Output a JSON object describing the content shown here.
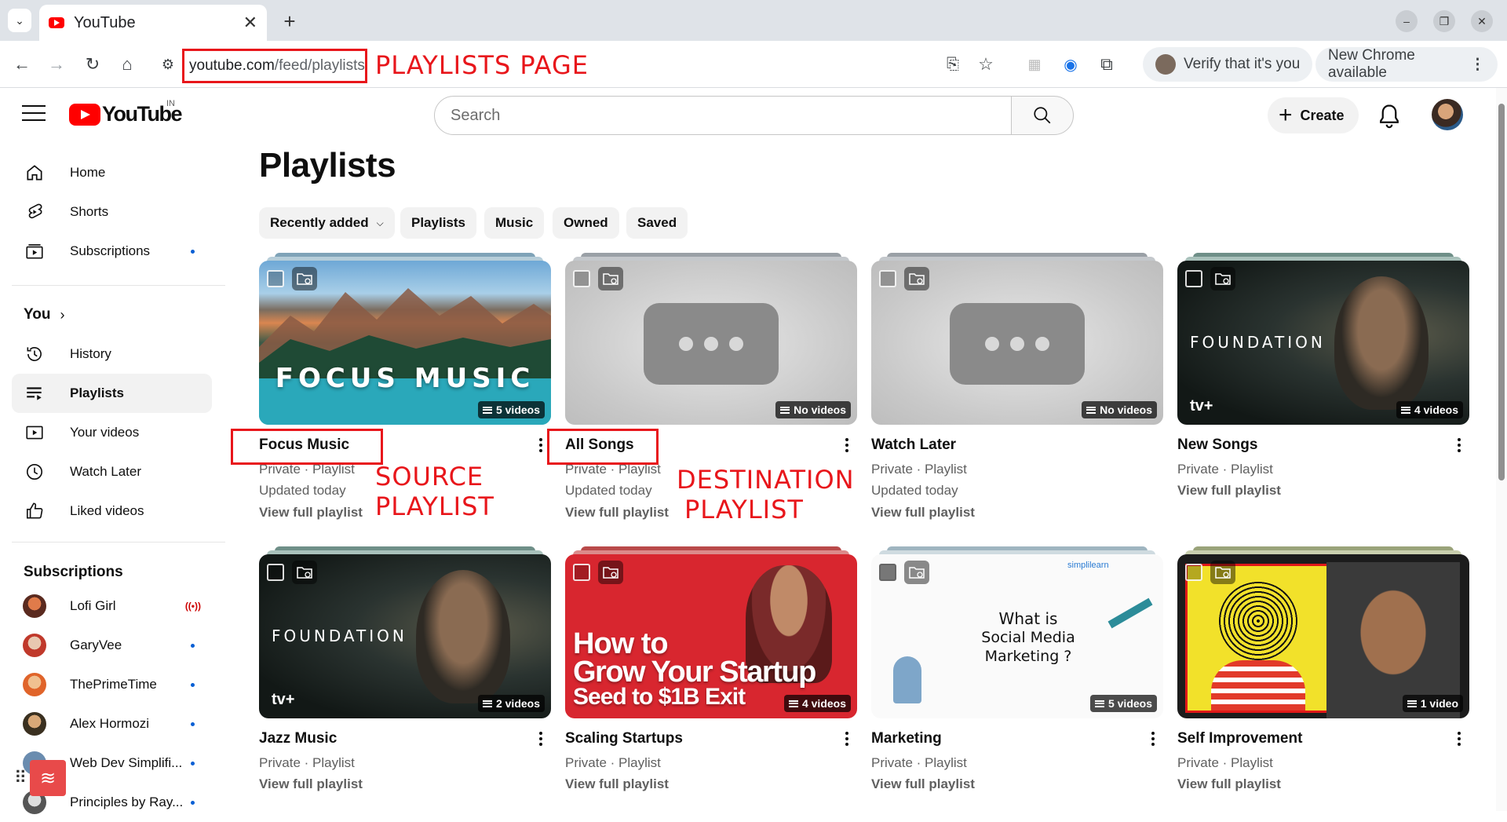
{
  "browser": {
    "tab_title": "YouTube",
    "url_host": "youtube.com",
    "url_path": "/feed/playlists",
    "verify_label": "Verify that it's you",
    "update_label": "New Chrome available"
  },
  "annotations": {
    "page_label": "PLAYLISTS PAGE",
    "source_label_line1": "SOURCE",
    "source_label_line2": "PLAYLIST",
    "dest_label_line1": "DESTINATION",
    "dest_label_line2": "PLAYLIST",
    "accent_color": "#e8161b"
  },
  "masthead": {
    "logo_text": "YouTube",
    "country_code": "IN",
    "search_placeholder": "Search",
    "create_label": "Create"
  },
  "sidebar": {
    "main": [
      {
        "label": "Home",
        "icon": "home-icon"
      },
      {
        "label": "Shorts",
        "icon": "shorts-icon"
      },
      {
        "label": "Subscriptions",
        "icon": "subscriptions-icon"
      }
    ],
    "you_title": "You",
    "you_items": [
      {
        "label": "History",
        "icon": "history-icon"
      },
      {
        "label": "Playlists",
        "icon": "playlists-icon"
      },
      {
        "label": "Your videos",
        "icon": "your-videos-icon"
      },
      {
        "label": "Watch Later",
        "icon": "watch-later-icon"
      },
      {
        "label": "Liked videos",
        "icon": "like-icon"
      }
    ],
    "subs_title": "Subscriptions",
    "subscriptions": [
      {
        "label": "Lofi Girl",
        "status": "live",
        "live_text": "((•))"
      },
      {
        "label": "GaryVee",
        "status": "new"
      },
      {
        "label": "ThePrimeTime",
        "status": "new"
      },
      {
        "label": "Alex Hormozi",
        "status": "new"
      },
      {
        "label": "Web Dev Simplifi...",
        "status": "new"
      },
      {
        "label": "Principles by Ray...",
        "status": "new"
      }
    ]
  },
  "main": {
    "title": "Playlists",
    "chips": [
      {
        "label": "Recently added",
        "has_caret": true
      },
      {
        "label": "Playlists"
      },
      {
        "label": "Music"
      },
      {
        "label": "Owned"
      },
      {
        "label": "Saved"
      }
    ],
    "playlists": [
      {
        "title": "Focus Music",
        "meta": "Private · Playlist",
        "updated": "Updated today",
        "link": "View full playlist",
        "count": "5 videos",
        "thumb_text": "FOCUS MUSIC"
      },
      {
        "title": "All Songs",
        "meta": "Private · Playlist",
        "updated": "Updated today",
        "link": "View full playlist",
        "count": "No videos"
      },
      {
        "title": "Watch Later",
        "meta": "Private · Playlist",
        "updated": "Updated today",
        "link": "View full playlist",
        "count": "No videos"
      },
      {
        "title": "New Songs",
        "meta": "Private · Playlist",
        "link": "View full playlist",
        "count": "4 videos",
        "thumb_text": "FOUNDATION",
        "thumb_brand": "tv+"
      },
      {
        "title": "Jazz Music",
        "meta": "Private · Playlist",
        "link": "View full playlist",
        "count": "2 videos",
        "thumb_text": "FOUNDATION",
        "thumb_brand": "tv+"
      },
      {
        "title": "Scaling Startups",
        "meta": "Private · Playlist",
        "link": "View full playlist",
        "count": "4 videos",
        "thumb_line1": "How to",
        "thumb_line2": "Grow Your Startup",
        "thumb_line3": "Seed to $1B Exit"
      },
      {
        "title": "Marketing",
        "meta": "Private · Playlist",
        "link": "View full playlist",
        "count": "5 videos",
        "thumb_line1": "What is",
        "thumb_line2": "Social Media Marketing ?",
        "thumb_brand": "simplilearn"
      },
      {
        "title": "Self Improvement",
        "meta": "Private · Playlist",
        "link": "View full playlist",
        "count": "1 video"
      }
    ]
  }
}
